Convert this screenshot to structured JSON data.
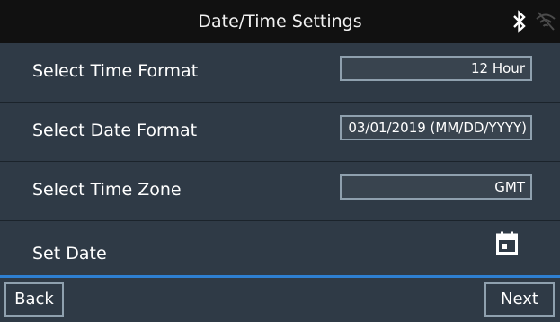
{
  "title_bar": {
    "title": "Date/Time Settings",
    "icons": [
      "bluetooth-icon",
      "wifi-disabled-icon"
    ]
  },
  "settings": [
    {
      "label": "Select Time Format",
      "value": "12 Hour"
    },
    {
      "label": "Select Date Format",
      "value": "03/01/2019 (MM/DD/YYYY)"
    },
    {
      "label": "Select Time Zone",
      "value": "GMT"
    },
    {
      "label": "Set Date",
      "icon": "calendar-icon"
    }
  ],
  "navigation": {
    "back_label": "Back",
    "next_label": "Next"
  },
  "colors": {
    "background": "#2f3a46",
    "title_bar": "#111111",
    "accent_line": "#2e7fd1",
    "box_border": "#8fa0ae"
  }
}
